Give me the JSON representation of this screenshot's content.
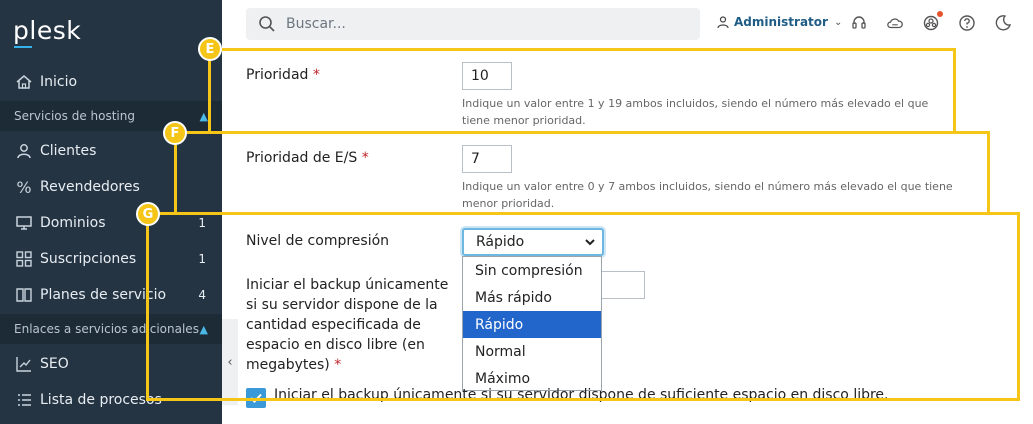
{
  "sidebar": {
    "logo": "plesk",
    "items": [
      {
        "label": "Inicio",
        "icon": "home-icon"
      },
      {
        "label": "Clientes",
        "icon": "user-icon"
      },
      {
        "label": "Revendedores",
        "icon": "percent-icon"
      },
      {
        "label": "Dominios",
        "icon": "monitor-icon",
        "count": "1"
      },
      {
        "label": "Suscripciones",
        "icon": "grid-icon",
        "count": "1"
      },
      {
        "label": "Planes de servicio",
        "icon": "book-icon",
        "count": "4"
      },
      {
        "label": "SEO",
        "icon": "chart-icon"
      },
      {
        "label": "Lista de procesos",
        "icon": "list-icon"
      }
    ],
    "sections": [
      {
        "label": "Servicios de hosting"
      },
      {
        "label": "Enlaces a servicios adicionales"
      }
    ],
    "collapse_glyph": "‹"
  },
  "header": {
    "search_placeholder": "Buscar...",
    "user": "Administrator"
  },
  "form": {
    "priority_label": "Prioridad",
    "priority_value": "10",
    "priority_hint_1": "Indique un valor entre 1 y 19 ambos incluidos, siendo el número más elevado el que",
    "priority_hint_2": "tiene menor prioridad.",
    "io_label": "Prioridad de E/S",
    "io_value": "7",
    "io_hint_1": "Indique un valor entre 0 y 7 ambos incluidos, siendo el número más elevado el que tiene",
    "io_hint_2": "menor prioridad.",
    "compression_label": "Nivel de compresión",
    "compression_selected": "Rápido",
    "compression_options": [
      "Sin compresión",
      "Más rápido",
      "Rápido",
      "Normal",
      "Máximo"
    ],
    "space_label_lines": [
      "Iniciar el backup únicamente",
      "si su servidor dispone de la",
      "cantidad especificada de",
      "espacio en disco libre (en",
      "megabytes)"
    ],
    "checkbox_label": "Iniciar el backup únicamente si su servidor dispone de suficiente espacio en disco libre.",
    "required_mark": "*"
  },
  "annotations": {
    "E": "E",
    "F": "F",
    "G": "G",
    "color": "#f5c518"
  }
}
